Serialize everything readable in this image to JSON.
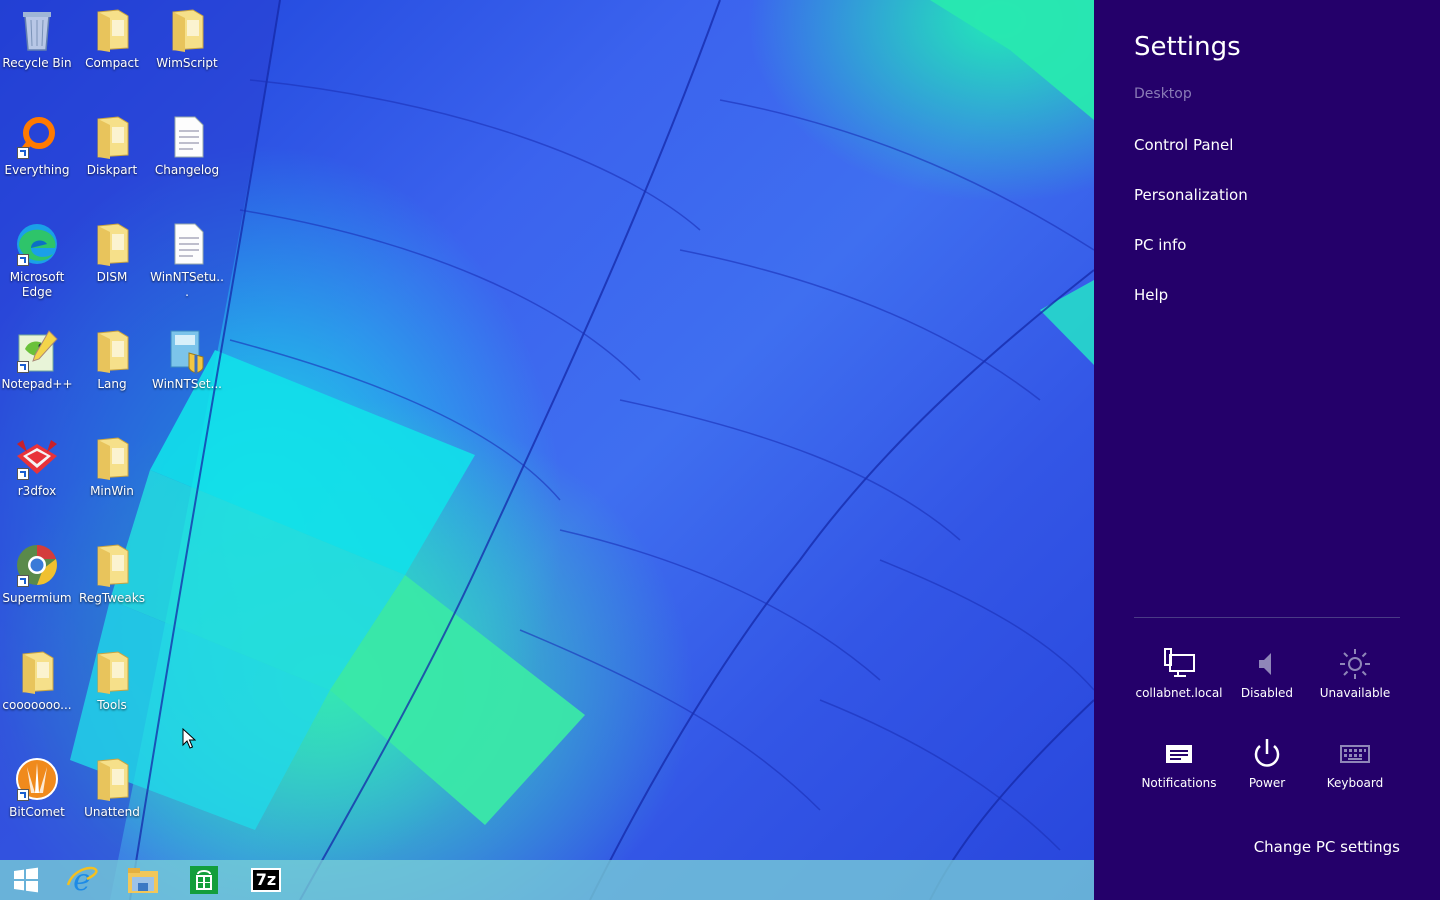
{
  "desktop": {
    "icons": [
      {
        "label": "Recycle Bin",
        "icon": "recycle-bin-icon"
      },
      {
        "label": "Compact",
        "icon": "folder-icon"
      },
      {
        "label": "WimScript",
        "icon": "folder-icon"
      },
      {
        "label": "Everything",
        "icon": "everything-icon"
      },
      {
        "label": "Diskpart",
        "icon": "folder-icon"
      },
      {
        "label": "Changelog",
        "icon": "document-icon"
      },
      {
        "label": "Microsoft Edge",
        "icon": "edge-icon"
      },
      {
        "label": "DISM",
        "icon": "folder-icon"
      },
      {
        "label": "WinNTSetu...",
        "icon": "document-icon"
      },
      {
        "label": "Notepad++",
        "icon": "notepadpp-icon"
      },
      {
        "label": "Lang",
        "icon": "folder-icon"
      },
      {
        "label": "WinNTSet...",
        "icon": "setup-app-icon"
      },
      {
        "label": "r3dfox",
        "icon": "r3dfox-icon"
      },
      {
        "label": "MinWin",
        "icon": "folder-icon"
      },
      {
        "label": "Supermium",
        "icon": "supermium-icon"
      },
      {
        "label": "RegTweaks",
        "icon": "folder-icon"
      },
      {
        "label": "cooooooo...",
        "icon": "folder-icon"
      },
      {
        "label": "Tools",
        "icon": "folder-icon"
      },
      {
        "label": "BitComet",
        "icon": "bitcomet-icon"
      },
      {
        "label": "Unattend",
        "icon": "folder-icon"
      }
    ]
  },
  "taskbar": {
    "items": [
      "start-button",
      "internet-explorer",
      "file-explorer",
      "store",
      "7zip"
    ],
    "sevenzip_label": "7z"
  },
  "settings": {
    "title": "Settings",
    "subtitle": "Desktop",
    "menu": [
      "Control Panel",
      "Personalization",
      "PC info",
      "Help"
    ],
    "quick": [
      {
        "label": "collabnet.local",
        "icon": "network-icon"
      },
      {
        "label": "Disabled",
        "icon": "volume-icon"
      },
      {
        "label": "Unavailable",
        "icon": "brightness-icon"
      },
      {
        "label": "Notifications",
        "icon": "notifications-icon"
      },
      {
        "label": "Power",
        "icon": "power-icon"
      },
      {
        "label": "Keyboard",
        "icon": "keyboard-icon"
      }
    ],
    "change_label": "Change PC settings",
    "background": "#24006a"
  }
}
